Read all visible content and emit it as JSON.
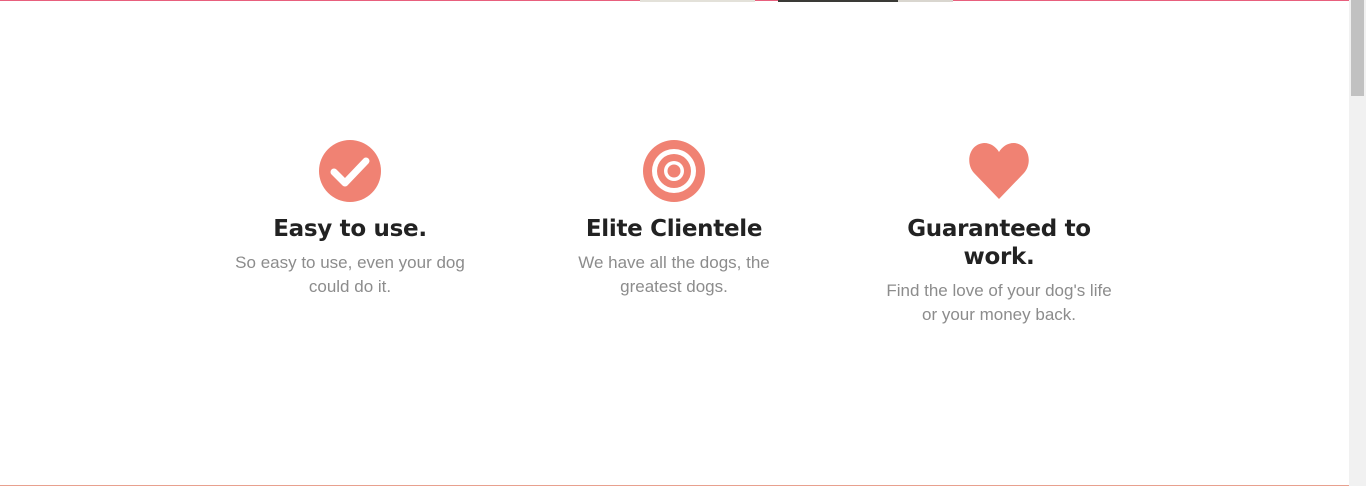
{
  "colors": {
    "accent": "#f08273",
    "title_text": "#222222",
    "body_text": "#8c8c8c",
    "top_edge": "#e8607d"
  },
  "features": [
    {
      "icon": "check-circle-icon",
      "title": "Easy to use.",
      "description": "So easy to use, even your dog could do it."
    },
    {
      "icon": "target-icon",
      "title": "Elite Clientele",
      "description": "We have all the dogs, the greatest dogs."
    },
    {
      "icon": "heart-icon",
      "title": "Guaranteed to work.",
      "description": "Find the love of your dog's life or your money back."
    }
  ]
}
